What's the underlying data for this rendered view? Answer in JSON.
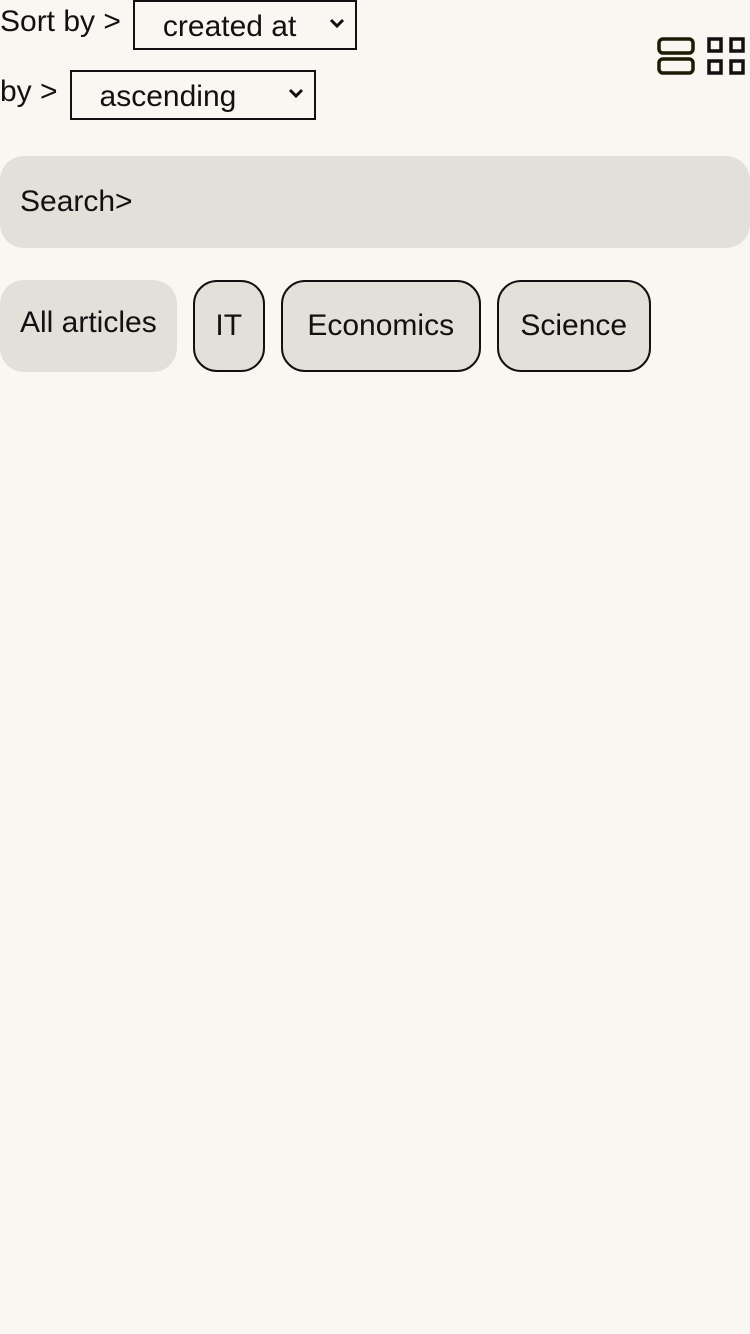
{
  "sort": {
    "label": "Sort by >",
    "field_value": "created at"
  },
  "order": {
    "label": "by >",
    "value": "ascending"
  },
  "view_toggle": {
    "list_icon": "list-view-icon",
    "grid_icon": "grid-view-icon"
  },
  "search": {
    "placeholder": "Search>"
  },
  "categories": [
    {
      "label": "All articles",
      "active": true
    },
    {
      "label": "IT",
      "active": false
    },
    {
      "label": "Economics",
      "active": false
    },
    {
      "label": "Science",
      "active": false
    }
  ],
  "colors": {
    "background": "#faf7f2",
    "chip_background": "#e3dfd9",
    "border": "#111111",
    "list_icon_stroke": "#1d1a06"
  }
}
